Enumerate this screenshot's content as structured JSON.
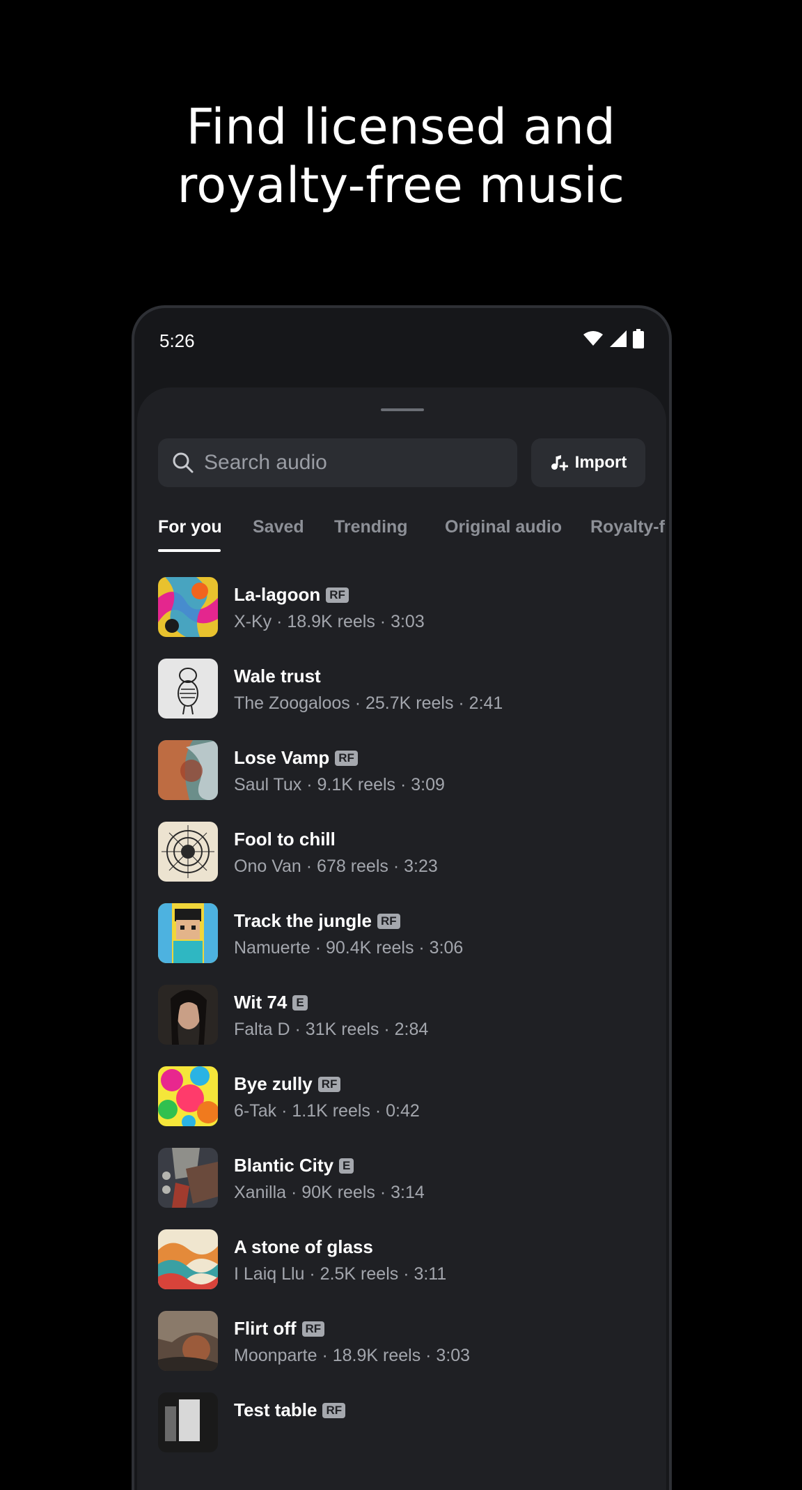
{
  "headline": {
    "line1": "Find licensed and",
    "line2": "royalty-free music"
  },
  "status_bar": {
    "time": "5:26",
    "icons": [
      "wifi-icon",
      "signal-icon",
      "battery-icon"
    ]
  },
  "search": {
    "placeholder": "Search audio"
  },
  "import_button": {
    "label": "Import",
    "icon": "music-note-plus-icon"
  },
  "tabs": [
    {
      "label": "For you",
      "active": true
    },
    {
      "label": "Saved",
      "active": false
    },
    {
      "label": "Trending",
      "active": false
    },
    {
      "label": "Original audio",
      "active": false
    },
    {
      "label": "Royalty-f",
      "active": false
    }
  ],
  "tracks": [
    {
      "title": "La-lagoon",
      "badge": "RF",
      "meta": "X-Ky · 18.9K reels · 3:03"
    },
    {
      "title": "Wale trust",
      "badge": "",
      "meta": "The Zoogaloos · 25.7K reels · 2:41"
    },
    {
      "title": "Lose Vamp",
      "badge": "RF",
      "meta": "Saul Tux · 9.1K reels · 3:09"
    },
    {
      "title": "Fool to chill",
      "badge": "",
      "meta": "Ono Van · 678 reels · 3:23"
    },
    {
      "title": "Track the jungle",
      "badge": "RF",
      "meta": "Namuerte · 90.4K reels · 3:06"
    },
    {
      "title": "Wit 74",
      "badge": "E",
      "meta": "Falta D · 31K reels · 2:84"
    },
    {
      "title": "Bye zully",
      "badge": "RF",
      "meta": "6-Tak · 1.1K reels · 0:42"
    },
    {
      "title": "Blantic City",
      "badge": "E",
      "meta": "Xanilla · 90K reels · 3:14"
    },
    {
      "title": "A stone of glass",
      "badge": "",
      "meta": "I Laiq Llu · 2.5K reels · 3:11"
    },
    {
      "title": "Flirt off",
      "badge": "RF",
      "meta": "Moonparte · 18.9K reels · 3:03"
    },
    {
      "title": "Test table",
      "badge": "RF",
      "meta": ""
    }
  ],
  "colors": {
    "background": "#000000",
    "sheet": "#1f2024",
    "field": "#2b2d32",
    "muted_text": "#a3a6ad"
  }
}
